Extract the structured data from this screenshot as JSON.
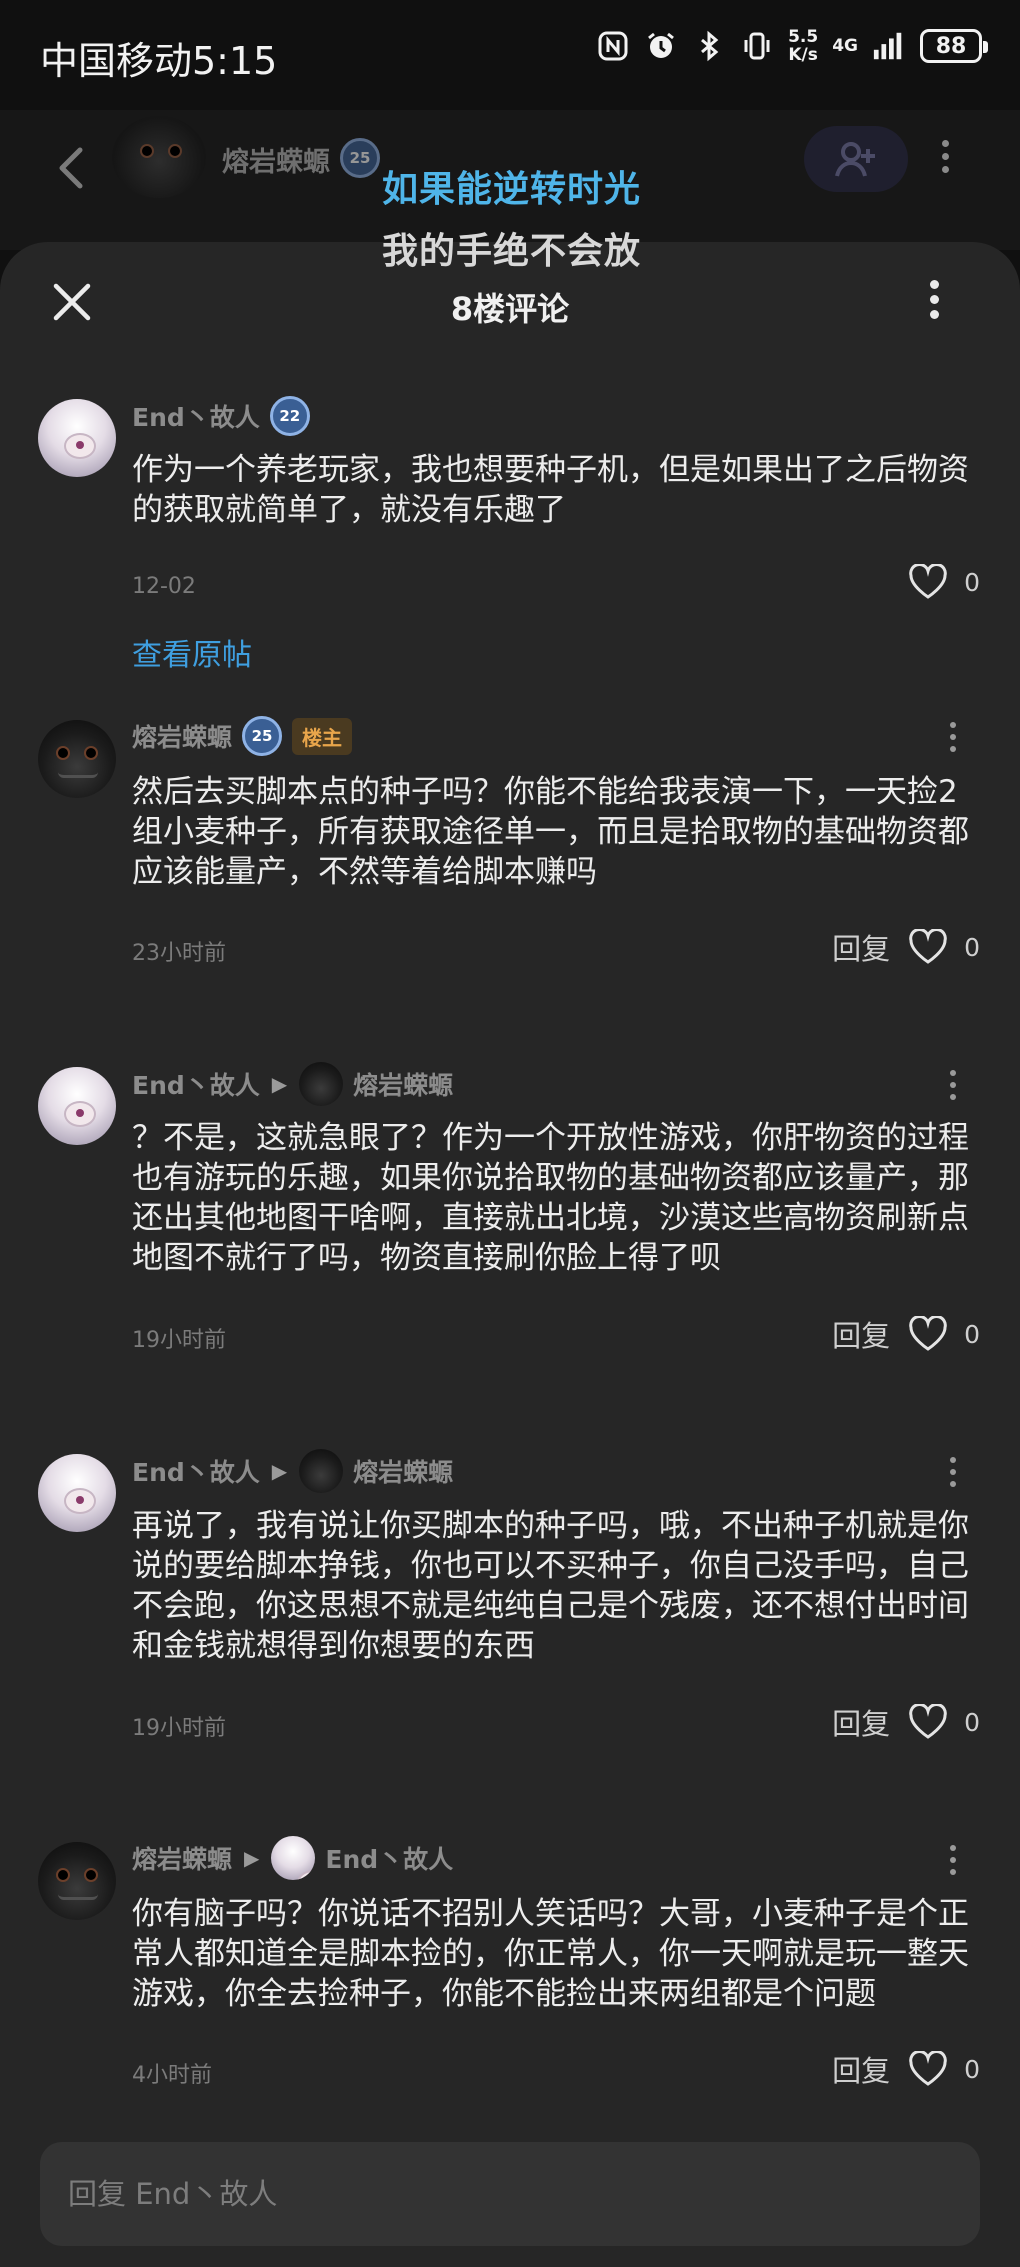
{
  "status_bar": {
    "carrier_time": "中国移动5:15",
    "net_speed_top": "5.5",
    "net_speed_bottom": "K/s",
    "network": "4G",
    "battery": "88"
  },
  "post_header": {
    "author_name": "熔岩蝾螈",
    "author_level": "25"
  },
  "lyrics": {
    "line1": "如果能逆转时光",
    "line2": "我的手绝不会放"
  },
  "sheet": {
    "title": "8楼评论"
  },
  "comments": [
    {
      "author": "End丶故人",
      "level": "22",
      "text": "作为一个养老玩家，我也想要种子机，但是如果出了之后物资的获取就简单了，就没有乐趣了",
      "time": "12-02",
      "likes": "0",
      "view_original": "查看原帖"
    },
    {
      "author": "熔岩蝾螈",
      "level": "25",
      "tag": "楼主",
      "text": "然后去买脚本点的种子吗？你能不能给我表演一下，一天捡2组小麦种子，所有获取途径单一，而且是拾取物的基础物资都应该能量产，不然等着给脚本赚吗",
      "time": "23小时前",
      "reply": "回复",
      "likes": "0"
    },
    {
      "author": "End丶故人",
      "reply_to": "熔岩蝾螈",
      "text": "？不是，这就急眼了？作为一个开放性游戏，你肝物资的过程也有游玩的乐趣，如果你说拾取物的基础物资都应该量产，那还出其他地图干啥啊，直接就出北境，沙漠这些高物资刷新点地图不就行了吗，物资直接刷你脸上得了呗",
      "time": "19小时前",
      "reply": "回复",
      "likes": "0"
    },
    {
      "author": "End丶故人",
      "reply_to": "熔岩蝾螈",
      "text": "再说了，我有说让你买脚本的种子吗，哦，不出种子机就是你说的要给脚本挣钱，你也可以不买种子，你自己没手吗，自己不会跑，你这思想不就是纯纯自己是个残废，还不想付出时间和金钱就想得到你想要的东西",
      "time": "19小时前",
      "reply": "回复",
      "likes": "0"
    },
    {
      "author": "熔岩蝾螈",
      "reply_to": "End丶故人",
      "text": "你有脑子吗？你说话不招别人笑话吗？大哥，小麦种子是个正常人都知道全是脚本捡的，你正常人，你一天啊就是玩一整天游戏，你全去捡种子，你能不能捡出来两组都是个问题",
      "time": "4小时前",
      "reply": "回复",
      "likes": "0"
    }
  ],
  "input": {
    "placeholder": "回复 End丶故人"
  },
  "icons": {
    "back": "chevron-left-icon",
    "follow": "add-user-icon",
    "close": "close-icon",
    "more": "more-vertical-icon",
    "like": "heart-icon"
  },
  "colors": {
    "sheet_bg": "#262626",
    "link_blue": "#3f9fe0",
    "lyric_blue": "#4fb5e9",
    "op_tag": "#e8a54b"
  }
}
